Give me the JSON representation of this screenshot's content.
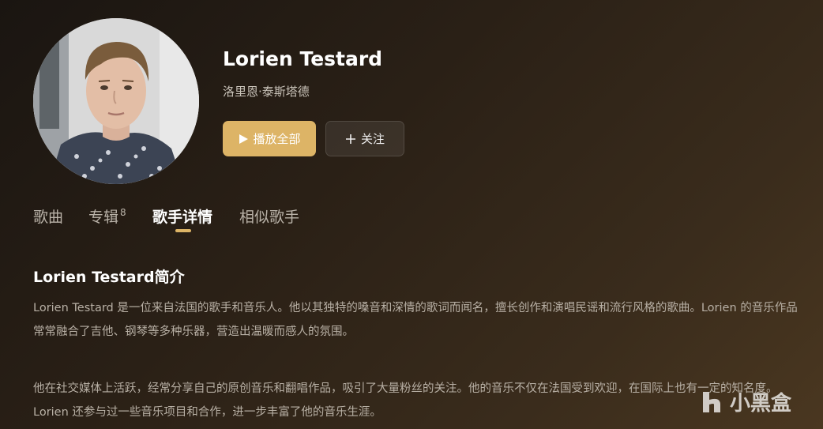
{
  "artist": {
    "name": "Lorien Testard",
    "alias": "洛里恩·泰斯塔德"
  },
  "actions": {
    "play_all": "播放全部",
    "follow": "关注",
    "play_icon": "play-icon",
    "follow_icon": "plus-icon"
  },
  "tabs": [
    {
      "label": "歌曲",
      "badge": ""
    },
    {
      "label": "专辑",
      "badge": "8"
    },
    {
      "label": "歌手详情",
      "badge": "",
      "active": true
    },
    {
      "label": "相似歌手",
      "badge": ""
    }
  ],
  "intro": {
    "title": "Lorien Testard简介",
    "paragraphs": [
      "Lorien Testard 是一位来自法国的歌手和音乐人。他以其独特的嗓音和深情的歌词而闻名，擅长创作和演唱民谣和流行风格的歌曲。Lorien 的音乐作品常常融合了吉他、钢琴等多种乐器，营造出温暖而感人的氛围。",
      "他在社交媒体上活跃，经常分享自己的原创音乐和翻唱作品，吸引了大量粉丝的关注。他的音乐不仅在法国受到欢迎，在国际上也有一定的知名度。Lorien 还参与过一些音乐项目和合作，进一步丰富了他的音乐生涯。"
    ]
  },
  "watermark": {
    "text": "小黑盒"
  },
  "colors": {
    "accent": "#ddb466",
    "text_primary": "#ffffff",
    "text_secondary": "#b8b0a5"
  }
}
